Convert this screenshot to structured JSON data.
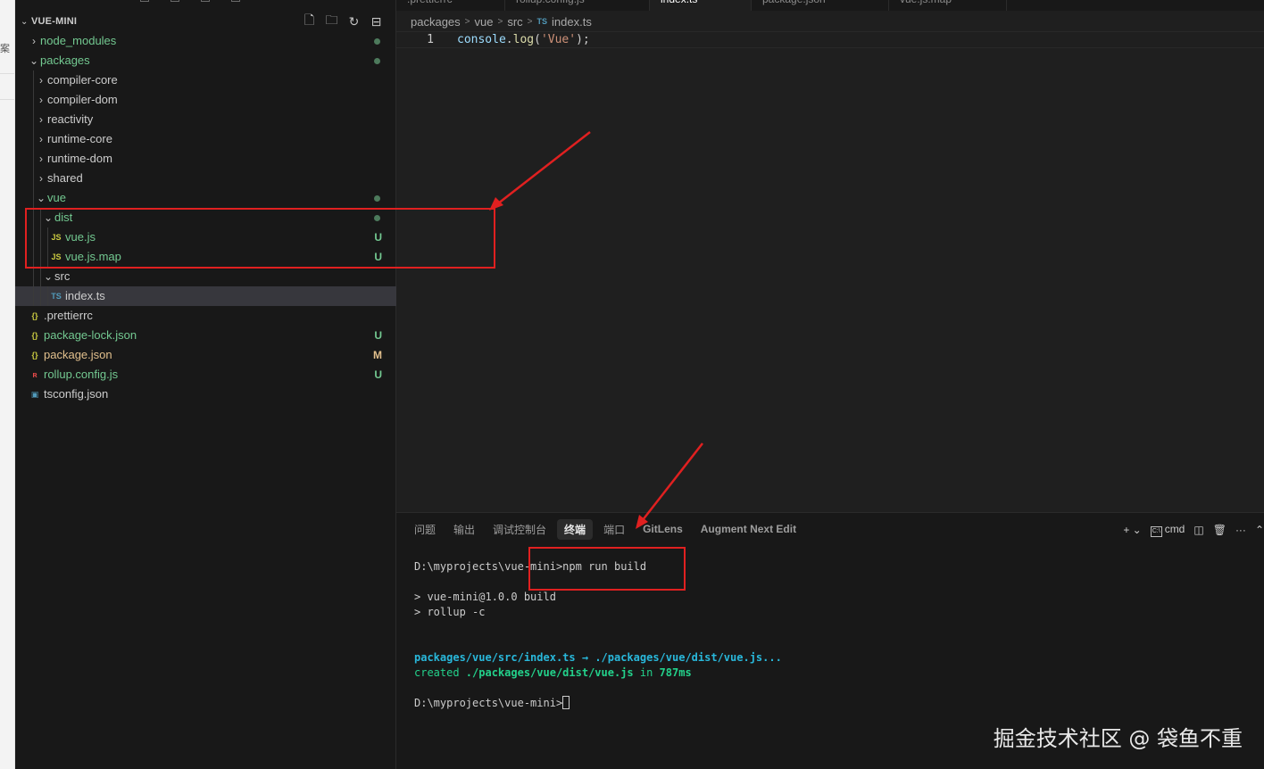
{
  "left_strip": {
    "char": "案"
  },
  "explorer": {
    "title": "VUE-MINI",
    "actions": [
      "new-file-icon",
      "new-folder-icon",
      "refresh-icon",
      "collapse-icon"
    ],
    "items": [
      {
        "label": "node_modules",
        "type": "folder",
        "depth": 0,
        "expanded": false,
        "status": "dot"
      },
      {
        "label": "packages",
        "type": "folder",
        "depth": 0,
        "expanded": true,
        "status": "dot"
      },
      {
        "label": "compiler-core",
        "type": "folder",
        "depth": 1,
        "expanded": false
      },
      {
        "label": "compiler-dom",
        "type": "folder",
        "depth": 1,
        "expanded": false
      },
      {
        "label": "reactivity",
        "type": "folder",
        "depth": 1,
        "expanded": false
      },
      {
        "label": "runtime-core",
        "type": "folder",
        "depth": 1,
        "expanded": false
      },
      {
        "label": "runtime-dom",
        "type": "folder",
        "depth": 1,
        "expanded": false
      },
      {
        "label": "shared",
        "type": "folder",
        "depth": 1,
        "expanded": false
      },
      {
        "label": "vue",
        "type": "folder",
        "depth": 1,
        "expanded": true,
        "status": "dot"
      },
      {
        "label": "dist",
        "type": "folder",
        "depth": 2,
        "expanded": true,
        "status": "dot"
      },
      {
        "label": "vue.js",
        "type": "file",
        "icon": "JS",
        "depth": 3,
        "badge": "U"
      },
      {
        "label": "vue.js.map",
        "type": "file",
        "icon": "JS",
        "depth": 3,
        "badge": "U"
      },
      {
        "label": "src",
        "type": "folder",
        "depth": 2,
        "expanded": true
      },
      {
        "label": "index.ts",
        "type": "file",
        "icon": "TS",
        "depth": 3,
        "selected": true
      },
      {
        "label": ".prettierrc",
        "type": "file",
        "icon": "{}",
        "depth": 0
      },
      {
        "label": "package-lock.json",
        "type": "file",
        "icon": "{}",
        "depth": 0,
        "badge": "U"
      },
      {
        "label": "package.json",
        "type": "file",
        "icon": "{}",
        "depth": 0,
        "badge": "M"
      },
      {
        "label": "rollup.config.js",
        "type": "file",
        "icon": "rollup",
        "depth": 0,
        "badge": "U"
      },
      {
        "label": "tsconfig.json",
        "type": "file",
        "icon": "TSC",
        "depth": 0
      }
    ]
  },
  "editor": {
    "tabs": [
      ".prettierrc",
      "rollup.config.js",
      "index.ts",
      "package.json",
      "vue.js.map"
    ],
    "active_tab": 2,
    "breadcrumb": [
      "packages",
      "vue",
      "src",
      "index.ts"
    ],
    "breadcrumb_file_icon": "TS",
    "line_number": "1",
    "code": {
      "obj": "console",
      "dot": ".",
      "fn": "log",
      "open": "(",
      "str": "'Vue'",
      "close": ");"
    }
  },
  "panel": {
    "tabs": [
      "问题",
      "输出",
      "调试控制台",
      "终端",
      "端口",
      "GitLens",
      "Augment Next Edit"
    ],
    "active_tab": 3,
    "actions": {
      "add": "+",
      "shell": "cmd",
      "split": "split-icon",
      "trash": "trash-icon",
      "more": "···",
      "chevron": "^"
    },
    "terminal": {
      "prompt1": "D:\\myprojects\\vue-mini>",
      "cmd1": "npm run build",
      "out1": "> vue-mini@1.0.0 build",
      "out2": "> rollup -c",
      "bundle_src": "packages/vue/src/index.ts",
      "bundle_arrow": " → ",
      "bundle_dest": "./packages/vue/dist/vue.js...",
      "created_label": "created ",
      "created_path": "./packages/vue/dist/vue.js",
      "created_in": " in ",
      "created_time": "787ms",
      "prompt2": "D:\\myprojects\\vue-mini>"
    }
  },
  "watermark": "掘金技术社区 @ 袋鱼不重",
  "colors": {
    "annotation_red": "#e02020",
    "git_untracked": "#73c991",
    "git_modified": "#e2c08d",
    "terminal_cyan": "#29b8db",
    "terminal_green": "#23d18b"
  }
}
